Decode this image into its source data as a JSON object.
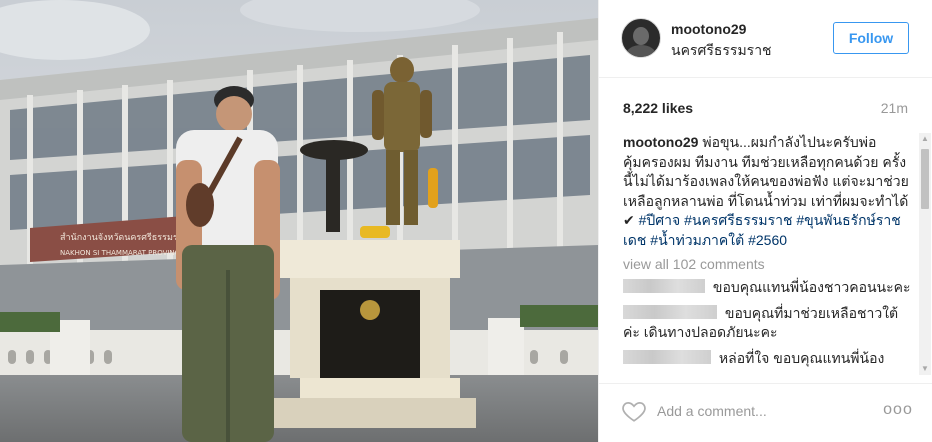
{
  "post": {
    "username": "mootono29",
    "location": "นครศรีธรรมราช",
    "follow_label": "Follow",
    "likes": "8,222 likes",
    "time": "21m"
  },
  "caption": {
    "username": "mootono29",
    "text": "พ่อขุน...ผมกำลังไปนะครับพ่อ คุ้มครองผม ทีมงาน ทีมช่วยเหลือทุกคนด้วย ครั้งนี้ไม่ได้มาร้องเพลงให้คนของพ่อฟัง แต่จะมาช่วยเหลือลูกหลานพ่อ ที่โดนน้ำท่วม เท่าที่ผมจะทำได้ ✔",
    "hashtags": [
      "#ปีศาจ",
      "#นครศรีธรรมราช",
      "#ขุนพันธรักษ์ราชเดช",
      "#น้ำท่วมภาคใต้",
      "#2560"
    ]
  },
  "view_all_label": "view all 102 comments",
  "comments": [
    {
      "text": "ขอบคุณแทนพี่น้องชาวคอนนะคะ"
    },
    {
      "text": "ขอบคุณที่มาช่วยเหลือชาวใต้ค่ะ เดินทางปลอดภัยนะคะ"
    },
    {
      "text": "หล่อที่ใจ ขอบคุณแทนพี่น้อง"
    }
  ],
  "photo": {
    "sign_thai": "สำนักงานจังหวัดนครศรีธรรมราช",
    "sign_english": "NAKHON SI THAMMARAT PROVINCIAL"
  },
  "footer": {
    "comment_placeholder": "Add a comment...",
    "more_label": "ooo"
  },
  "icons": {
    "like": "heart-icon",
    "more": "more-options-icon",
    "avatar": "avatar"
  },
  "colors": {
    "follow_blue": "#3897f0",
    "hashtag": "#003569",
    "muted": "#999999",
    "border": "#efefef"
  }
}
